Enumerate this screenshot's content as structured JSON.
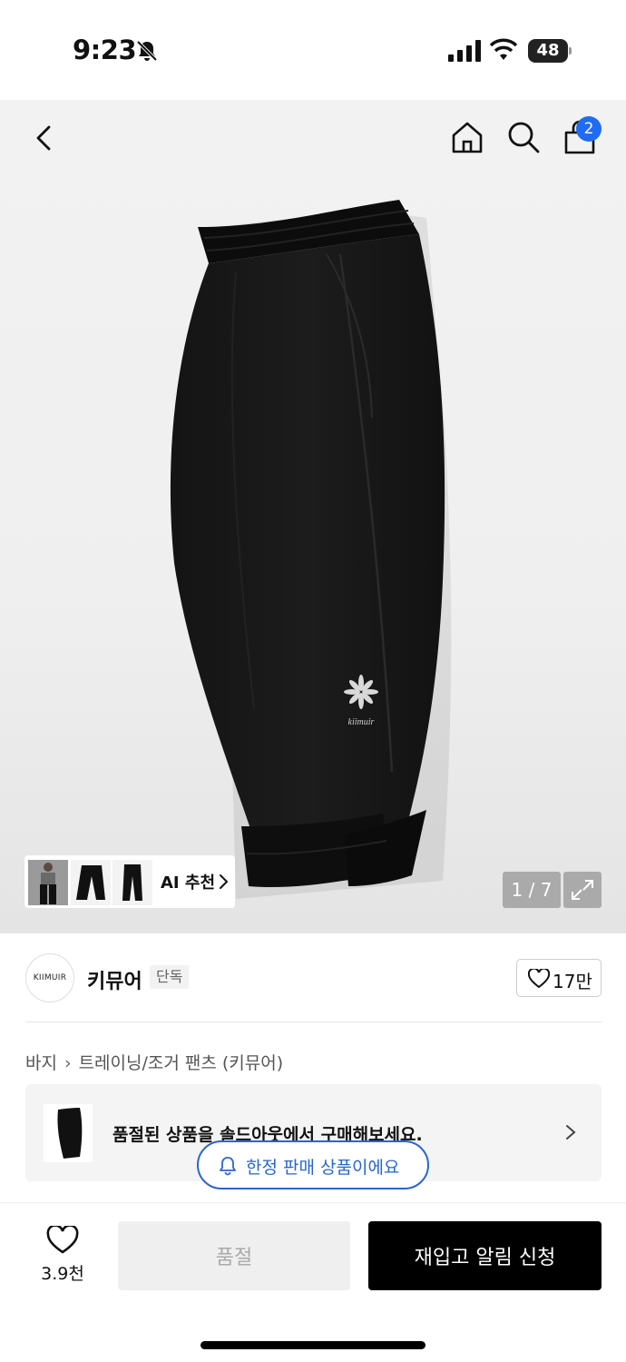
{
  "status_bar": {
    "time": "9:23",
    "battery": "48",
    "battery_level": 48
  },
  "nav": {
    "cart_count": "2"
  },
  "gallery": {
    "ai_recommend_label": "AI 추천",
    "page_counter": "1 / 7",
    "print_text": "kiimuir"
  },
  "brand": {
    "logo_text": "KIIMUIR",
    "name": "키뮤어",
    "badge": "단독",
    "likes": "17만"
  },
  "breadcrumb": {
    "items": [
      "바지",
      "트레이닝/조거 팬츠 (키뮤어)"
    ]
  },
  "soldout_banner": {
    "text": "품절된 상품을 솔드아웃에서 구매해보세요."
  },
  "limited_notice": {
    "text": "한정 판매 상품이에요"
  },
  "bottom_bar": {
    "wishlist_count": "3.9천",
    "soldout_label": "품절",
    "restock_label": "재입고 알림 신청"
  },
  "colors": {
    "accent_blue": "#1f6cf0",
    "pill_blue": "#2a66c9",
    "primary_button": "#000000"
  },
  "icons": [
    "back-icon",
    "home-icon",
    "search-icon",
    "cart-icon",
    "bell-icon",
    "heart-icon",
    "expand-icon",
    "chevron-right-icon"
  ]
}
